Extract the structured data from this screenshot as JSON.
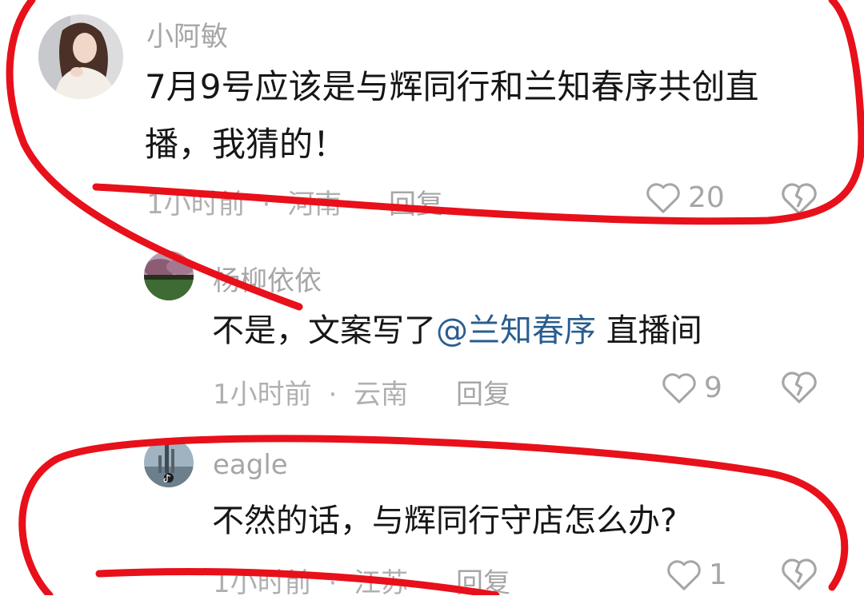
{
  "comments": [
    {
      "username": "小阿敏",
      "text_line1": "7月9号应该是与辉同行和兰知春序共创直",
      "text_line2": "播，我猜的！",
      "time": "1小时前",
      "sep": "·",
      "location": "河南",
      "reply_label": "回复",
      "likes": "20"
    },
    {
      "username": "杨柳依依",
      "text_prefix": "不是，文案写了",
      "mention": "@兰知春序",
      "text_suffix": " 直播间",
      "time": "1小时前",
      "sep": "·",
      "location": "云南",
      "reply_label": "回复",
      "likes": "9"
    },
    {
      "username": "eagle",
      "text_line1": "不然的话，与辉同行守店怎么办?",
      "time": "1小时前",
      "sep": "·",
      "location": "江苏",
      "reply_label": "回复",
      "likes": "1"
    }
  ],
  "icons": {
    "like": "heart-outline-icon",
    "dislike": "broken-heart-icon"
  },
  "colors": {
    "mention": "#2a5d8f",
    "annotation": "#e8101a",
    "muted_text": "#a6a6a6"
  }
}
